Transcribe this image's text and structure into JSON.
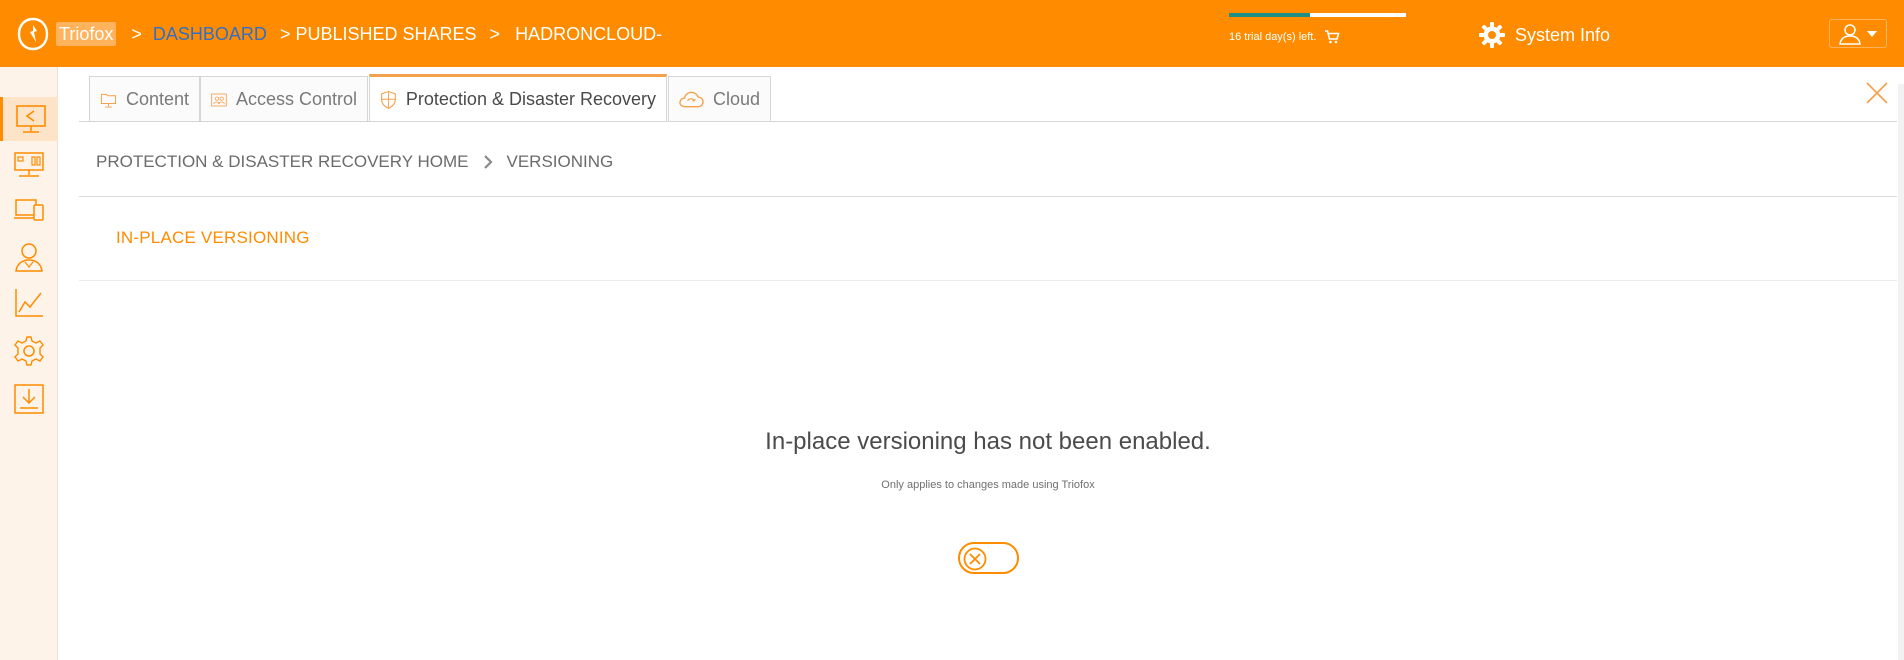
{
  "header": {
    "brand": "Triofox",
    "crumbs": [
      ">",
      "DASHBOARD",
      "> PUBLISHED SHARES",
      ">",
      "HADRONCLOUD-"
    ],
    "trial_text": "16 trial day(s) left.",
    "trial_progress": 0.46,
    "system_info": "System Info"
  },
  "sidebar": {
    "items": [
      {
        "icon": "shares-icon",
        "active": true
      },
      {
        "icon": "servers-icon",
        "active": false
      },
      {
        "icon": "devices-icon",
        "active": false
      },
      {
        "icon": "users-icon",
        "active": false
      },
      {
        "icon": "reports-icon",
        "active": false
      },
      {
        "icon": "settings-icon",
        "active": false
      },
      {
        "icon": "downloads-icon",
        "active": false
      }
    ]
  },
  "tabs": [
    {
      "label": "Content",
      "icon": "folder-monitor-icon"
    },
    {
      "label": "Access Control",
      "icon": "access-control-icon"
    },
    {
      "label": "Protection & Disaster Recovery",
      "icon": "shield-icon",
      "active": true
    },
    {
      "label": "Cloud",
      "icon": "cloud-icon"
    }
  ],
  "breadcrumb": {
    "home": "PROTECTION & DISASTER RECOVERY HOME",
    "current": "VERSIONING"
  },
  "section": {
    "title": "IN-PLACE VERSIONING"
  },
  "status": {
    "message": "In-place versioning has not been enabled.",
    "sub_message": "Only applies to changes made using Triofox",
    "toggle_enabled": false
  },
  "colors": {
    "accent": "#ff8c00",
    "link": "#2f6fc9",
    "progress": "#1e8f85"
  }
}
